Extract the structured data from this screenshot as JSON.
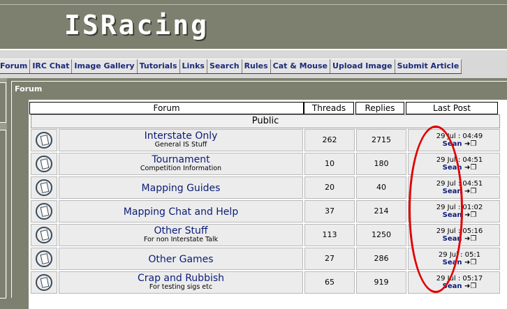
{
  "header": {
    "logo_text": "ISRacing"
  },
  "nav": {
    "items": [
      {
        "label": "Forum"
      },
      {
        "label": "IRC Chat"
      },
      {
        "label": "Image Gallery"
      },
      {
        "label": "Tutorials"
      },
      {
        "label": "Links"
      },
      {
        "label": "Search"
      },
      {
        "label": "Rules"
      },
      {
        "label": "Cat & Mouse"
      },
      {
        "label": "Upload Image"
      },
      {
        "label": "Submit Article"
      }
    ]
  },
  "panel": {
    "title": "Forum"
  },
  "table": {
    "headers": {
      "forum": "Forum",
      "threads": "Threads",
      "replies": "Replies",
      "last_post": "Last Post"
    },
    "section": "Public",
    "rows": [
      {
        "name": "Interstate Only",
        "desc": "General IS Stuff",
        "threads": "262",
        "replies": "2715",
        "last_date": "29 Jul : 04:49",
        "last_user": "Sean"
      },
      {
        "name": "Tournament",
        "desc": "Competition Information",
        "threads": "10",
        "replies": "180",
        "last_date": "29 Jul : 04:51",
        "last_user": "Sean"
      },
      {
        "name": "Mapping Guides",
        "desc": "",
        "threads": "20",
        "replies": "40",
        "last_date": "29 Jul : 04:51",
        "last_user": "Sean"
      },
      {
        "name": "Mapping Chat and Help",
        "desc": "",
        "threads": "37",
        "replies": "214",
        "last_date": "29 Jul : 01:02",
        "last_user": "Sean"
      },
      {
        "name": "Other Stuff",
        "desc": "For non Interstate Talk",
        "threads": "113",
        "replies": "1250",
        "last_date": "29 Jul : 05:16",
        "last_user": "Sean"
      },
      {
        "name": "Other Games",
        "desc": "",
        "threads": "27",
        "replies": "286",
        "last_date": "29 Jul : 05:1",
        "last_user": "Sean"
      },
      {
        "name": "Crap and Rubbish",
        "desc": "For testing sigs etc",
        "threads": "65",
        "replies": "919",
        "last_date": "29 Jul : 05:17",
        "last_user": "Sean"
      }
    ]
  },
  "annotation": {
    "color": "#e00000"
  }
}
